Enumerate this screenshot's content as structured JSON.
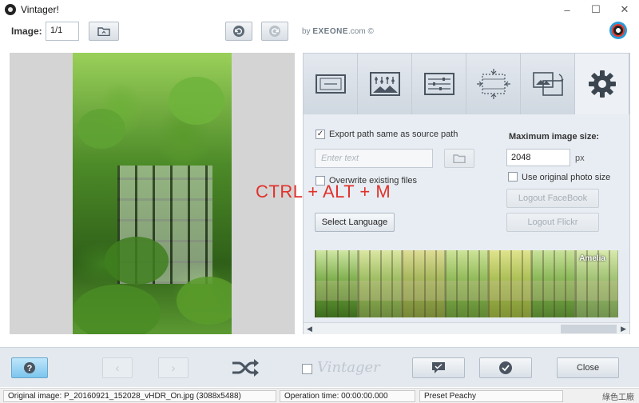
{
  "window": {
    "title": "Vintager!",
    "controls": [
      "–",
      "☐",
      "✕"
    ]
  },
  "toolbar": {
    "image_label": "Image:",
    "image_value": "1/1",
    "brand_by": "by",
    "brand_name": "EXEONE",
    "brand_suffix": ".com ©"
  },
  "tabs": [
    {
      "icon": "frame-icon"
    },
    {
      "icon": "photo-levels-icon"
    },
    {
      "icon": "sliders-icon"
    },
    {
      "icon": "crop-resize-icon"
    },
    {
      "icon": "rotate-photo-icon"
    },
    {
      "icon": "gear-icon",
      "active": true
    }
  ],
  "settings": {
    "export_same_path_label": "Export path same as source path",
    "export_same_path_checked": true,
    "path_placeholder": "Enter text",
    "overwrite_label": "Overwrite existing files",
    "overwrite_checked": false,
    "select_language_label": "Select Language",
    "max_size_label": "Maximum image size:",
    "max_size_value": "2048",
    "max_size_unit": "px",
    "use_original_label": "Use original photo size",
    "use_original_checked": false,
    "logout_facebook_label": "Logout FaceBook",
    "logout_flickr_label": "Logout Flickr"
  },
  "overlay": {
    "shortcut_text": "CTRL + ALT + M"
  },
  "presets": {
    "current_label": "Amelia",
    "count": 7
  },
  "bottom": {
    "close_label": "Close",
    "vintager_logo_text": "Vintager"
  },
  "status": {
    "original_image": "Original image: P_20160921_152028_vHDR_On.jpg (3088x5488)",
    "operation_time": "Operation time: 00:00:00.000",
    "preset": "Preset Peachy",
    "watermark": "綠色工廠"
  },
  "colors": {
    "accent_red": "#e0322c",
    "help_button_blue": "#7cc5ee",
    "panel_bg": "#e7ecf2"
  }
}
